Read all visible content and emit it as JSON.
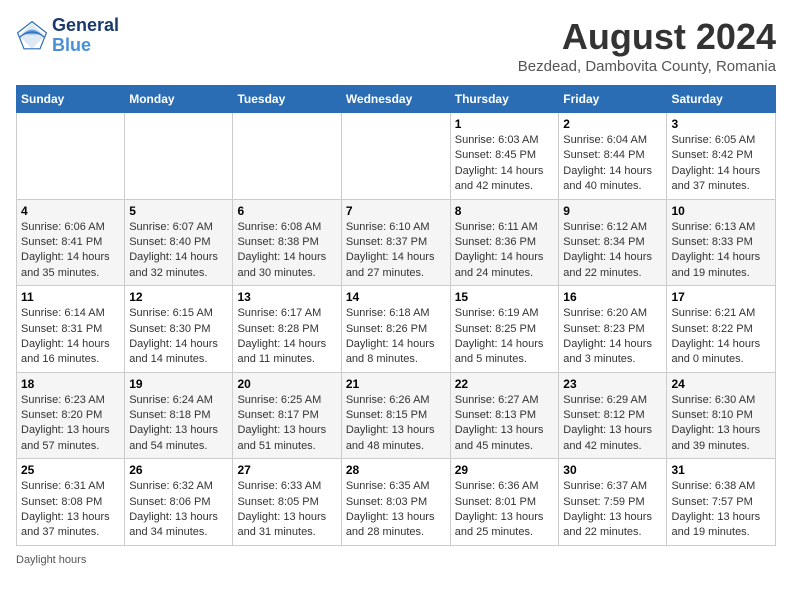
{
  "header": {
    "logo_line1": "General",
    "logo_line2": "Blue",
    "month_year": "August 2024",
    "location": "Bezdead, Dambovita County, Romania"
  },
  "days_of_week": [
    "Sunday",
    "Monday",
    "Tuesday",
    "Wednesday",
    "Thursday",
    "Friday",
    "Saturday"
  ],
  "weeks": [
    [
      {
        "day": "",
        "info": ""
      },
      {
        "day": "",
        "info": ""
      },
      {
        "day": "",
        "info": ""
      },
      {
        "day": "",
        "info": ""
      },
      {
        "day": "1",
        "info": "Sunrise: 6:03 AM\nSunset: 8:45 PM\nDaylight: 14 hours and 42 minutes."
      },
      {
        "day": "2",
        "info": "Sunrise: 6:04 AM\nSunset: 8:44 PM\nDaylight: 14 hours and 40 minutes."
      },
      {
        "day": "3",
        "info": "Sunrise: 6:05 AM\nSunset: 8:42 PM\nDaylight: 14 hours and 37 minutes."
      }
    ],
    [
      {
        "day": "4",
        "info": "Sunrise: 6:06 AM\nSunset: 8:41 PM\nDaylight: 14 hours and 35 minutes."
      },
      {
        "day": "5",
        "info": "Sunrise: 6:07 AM\nSunset: 8:40 PM\nDaylight: 14 hours and 32 minutes."
      },
      {
        "day": "6",
        "info": "Sunrise: 6:08 AM\nSunset: 8:38 PM\nDaylight: 14 hours and 30 minutes."
      },
      {
        "day": "7",
        "info": "Sunrise: 6:10 AM\nSunset: 8:37 PM\nDaylight: 14 hours and 27 minutes."
      },
      {
        "day": "8",
        "info": "Sunrise: 6:11 AM\nSunset: 8:36 PM\nDaylight: 14 hours and 24 minutes."
      },
      {
        "day": "9",
        "info": "Sunrise: 6:12 AM\nSunset: 8:34 PM\nDaylight: 14 hours and 22 minutes."
      },
      {
        "day": "10",
        "info": "Sunrise: 6:13 AM\nSunset: 8:33 PM\nDaylight: 14 hours and 19 minutes."
      }
    ],
    [
      {
        "day": "11",
        "info": "Sunrise: 6:14 AM\nSunset: 8:31 PM\nDaylight: 14 hours and 16 minutes."
      },
      {
        "day": "12",
        "info": "Sunrise: 6:15 AM\nSunset: 8:30 PM\nDaylight: 14 hours and 14 minutes."
      },
      {
        "day": "13",
        "info": "Sunrise: 6:17 AM\nSunset: 8:28 PM\nDaylight: 14 hours and 11 minutes."
      },
      {
        "day": "14",
        "info": "Sunrise: 6:18 AM\nSunset: 8:26 PM\nDaylight: 14 hours and 8 minutes."
      },
      {
        "day": "15",
        "info": "Sunrise: 6:19 AM\nSunset: 8:25 PM\nDaylight: 14 hours and 5 minutes."
      },
      {
        "day": "16",
        "info": "Sunrise: 6:20 AM\nSunset: 8:23 PM\nDaylight: 14 hours and 3 minutes."
      },
      {
        "day": "17",
        "info": "Sunrise: 6:21 AM\nSunset: 8:22 PM\nDaylight: 14 hours and 0 minutes."
      }
    ],
    [
      {
        "day": "18",
        "info": "Sunrise: 6:23 AM\nSunset: 8:20 PM\nDaylight: 13 hours and 57 minutes."
      },
      {
        "day": "19",
        "info": "Sunrise: 6:24 AM\nSunset: 8:18 PM\nDaylight: 13 hours and 54 minutes."
      },
      {
        "day": "20",
        "info": "Sunrise: 6:25 AM\nSunset: 8:17 PM\nDaylight: 13 hours and 51 minutes."
      },
      {
        "day": "21",
        "info": "Sunrise: 6:26 AM\nSunset: 8:15 PM\nDaylight: 13 hours and 48 minutes."
      },
      {
        "day": "22",
        "info": "Sunrise: 6:27 AM\nSunset: 8:13 PM\nDaylight: 13 hours and 45 minutes."
      },
      {
        "day": "23",
        "info": "Sunrise: 6:29 AM\nSunset: 8:12 PM\nDaylight: 13 hours and 42 minutes."
      },
      {
        "day": "24",
        "info": "Sunrise: 6:30 AM\nSunset: 8:10 PM\nDaylight: 13 hours and 39 minutes."
      }
    ],
    [
      {
        "day": "25",
        "info": "Sunrise: 6:31 AM\nSunset: 8:08 PM\nDaylight: 13 hours and 37 minutes."
      },
      {
        "day": "26",
        "info": "Sunrise: 6:32 AM\nSunset: 8:06 PM\nDaylight: 13 hours and 34 minutes."
      },
      {
        "day": "27",
        "info": "Sunrise: 6:33 AM\nSunset: 8:05 PM\nDaylight: 13 hours and 31 minutes."
      },
      {
        "day": "28",
        "info": "Sunrise: 6:35 AM\nSunset: 8:03 PM\nDaylight: 13 hours and 28 minutes."
      },
      {
        "day": "29",
        "info": "Sunrise: 6:36 AM\nSunset: 8:01 PM\nDaylight: 13 hours and 25 minutes."
      },
      {
        "day": "30",
        "info": "Sunrise: 6:37 AM\nSunset: 7:59 PM\nDaylight: 13 hours and 22 minutes."
      },
      {
        "day": "31",
        "info": "Sunrise: 6:38 AM\nSunset: 7:57 PM\nDaylight: 13 hours and 19 minutes."
      }
    ]
  ],
  "footer": {
    "daylight_label": "Daylight hours"
  }
}
